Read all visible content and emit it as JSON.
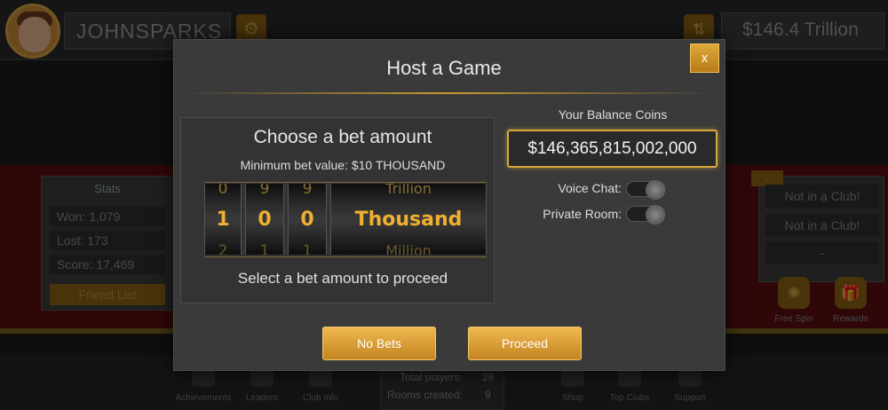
{
  "header": {
    "username": "JOHNSPARKS",
    "balance": "$146.4 Trillion"
  },
  "stats": {
    "title": "Stats",
    "won": "Won: 1,079",
    "lost": "Lost: 173",
    "score": "Score: 17,469",
    "friend_list": "Friend List"
  },
  "club": {
    "tag": "-",
    "row1": "Not in a Club!",
    "row2": "Not in a Club!",
    "row3": "-",
    "free_spin": "Free Spin",
    "rewards": "Rewards"
  },
  "bottom_nav": {
    "achievements": "Achievements",
    "leaders": "Leaders",
    "club_info": "Club Info",
    "total_players_label": "Total players:",
    "total_players_value": "29",
    "rooms_created_label": "Rooms created:",
    "rooms_created_value": "9",
    "shop": "Shop",
    "top_clubs": "Top Clubs",
    "support": "Support"
  },
  "modal": {
    "title": "Host a Game",
    "close_label": "x",
    "bet_title": "Choose a bet amount",
    "min_bet": "Minimum bet value: $10 THOUSAND",
    "bet_hint": "Select a bet amount to proceed",
    "wheels": [
      {
        "prev": "0",
        "current": "1",
        "next": "2"
      },
      {
        "prev": "9",
        "current": "0",
        "next": "1"
      },
      {
        "prev": "9",
        "current": "0",
        "next": "1"
      },
      {
        "prev": "Trillion",
        "current": "Thousand",
        "next": "Million"
      }
    ],
    "balance_label": "Your Balance Coins",
    "balance_value": "$146,365,815,002,000",
    "voice_chat_label": "Voice Chat:",
    "private_room_label": "Private Room:",
    "no_bets_label": "No Bets",
    "proceed_label": "Proceed"
  },
  "colors": {
    "accent_gold": "#d9a83a",
    "wheel_digit": "#f0b030",
    "felt_red": "#5a0f12"
  }
}
